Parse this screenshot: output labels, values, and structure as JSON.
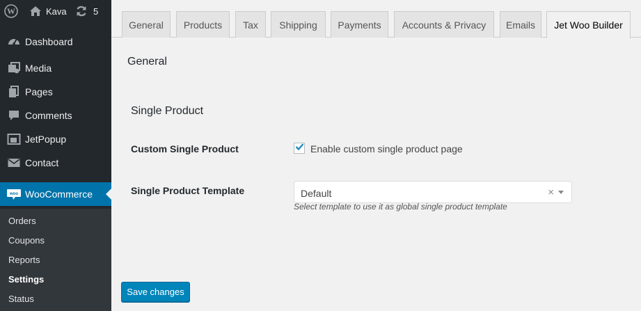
{
  "adminbar": {
    "site_name": "Kava",
    "updates_count": "5"
  },
  "menu": {
    "items": [
      {
        "label": "Dashboard",
        "icon": "dashboard-icon"
      },
      {
        "label": "Media",
        "icon": "media-icon"
      },
      {
        "label": "Pages",
        "icon": "pages-icon"
      },
      {
        "label": "Comments",
        "icon": "comments-icon"
      },
      {
        "label": "JetPopup",
        "icon": "jetpopup-icon"
      },
      {
        "label": "Contact",
        "icon": "mail-icon"
      },
      {
        "label": "WooCommerce",
        "icon": "woocommerce-icon"
      }
    ],
    "submenu": [
      "Orders",
      "Coupons",
      "Reports",
      "Settings",
      "Status"
    ]
  },
  "tabs": [
    "General",
    "Products",
    "Tax",
    "Shipping",
    "Payments",
    "Accounts & Privacy",
    "Emails",
    "Jet Woo Builder"
  ],
  "content": {
    "page_heading": "General",
    "section_heading": "Single Product",
    "custom_single_product": {
      "label": "Custom Single Product",
      "checkbox_label": "Enable custom single product page",
      "checked": true
    },
    "template": {
      "label": "Single Product Template",
      "value": "Default",
      "clear": "×",
      "description": "Select template to use it as global single product template"
    },
    "save_label": "Save changes"
  },
  "colors": {
    "sidebar_bg": "#23282d",
    "submenu_bg": "#32373c",
    "accent": "#0073aa",
    "button": "#0085ba"
  }
}
